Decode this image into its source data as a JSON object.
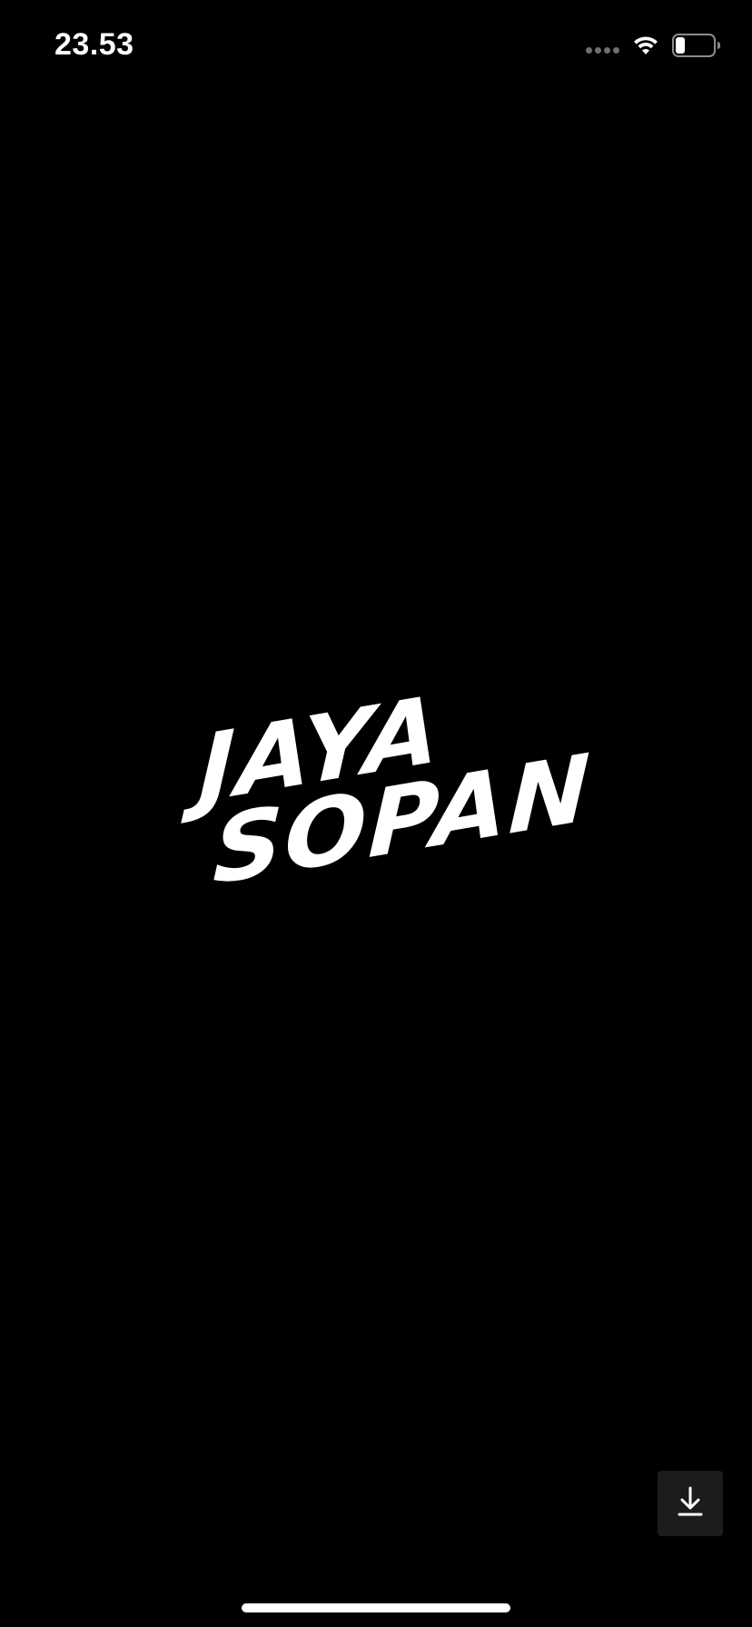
{
  "status_bar": {
    "time": "23.53",
    "signal_icon": "cellular-signal-dots",
    "wifi_icon": "wifi-icon",
    "battery_icon": "battery-icon",
    "battery_level": 0.2
  },
  "splash": {
    "logo_line_1": "JAYA",
    "logo_line_2": "SOPAN"
  },
  "download_button": {
    "icon": "download-icon"
  },
  "colors": {
    "background": "#000000",
    "foreground": "#ffffff",
    "button_background": "#1c1c1e"
  }
}
